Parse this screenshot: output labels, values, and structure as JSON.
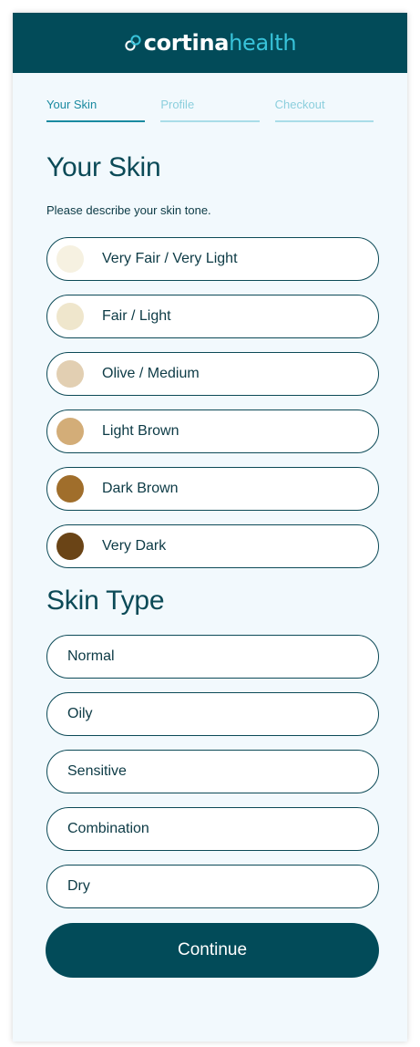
{
  "brand": {
    "name_part1": "cortina",
    "name_part2": "health",
    "logo_icon": "interlocking-rings-icon",
    "primary_color": "#024b59",
    "accent_color": "#38c3da"
  },
  "steps": [
    {
      "label": "Your Skin",
      "active": true
    },
    {
      "label": "Profile",
      "active": false
    },
    {
      "label": "Checkout",
      "active": false
    }
  ],
  "skin_tone": {
    "title": "Your Skin",
    "subtitle": "Please describe your skin tone.",
    "options": [
      {
        "label": "Very Fair / Very Light",
        "color": "#f6f1e1"
      },
      {
        "label": "Fair / Light",
        "color": "#efe6cc"
      },
      {
        "label": "Olive / Medium",
        "color": "#e2cfb2"
      },
      {
        "label": "Light Brown",
        "color": "#d3ad78"
      },
      {
        "label": "Dark Brown",
        "color": "#a06e2b"
      },
      {
        "label": "Very Dark",
        "color": "#6a4416"
      }
    ]
  },
  "skin_type": {
    "title": "Skin Type",
    "options": [
      {
        "label": "Normal"
      },
      {
        "label": "Oily"
      },
      {
        "label": "Sensitive"
      },
      {
        "label": "Combination"
      },
      {
        "label": "Dry"
      }
    ]
  },
  "continue_label": "Continue"
}
